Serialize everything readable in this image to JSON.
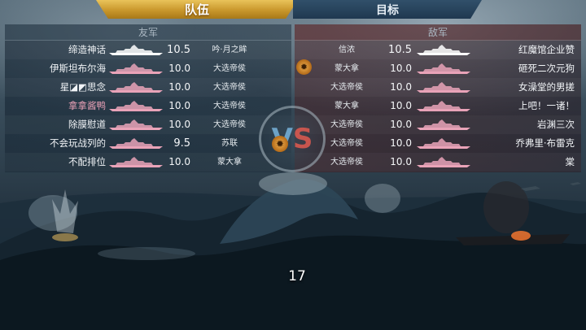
{
  "tabs": {
    "squad_label": "队伍",
    "target_label": "目标"
  },
  "ally": {
    "header": "友军",
    "rows": [
      {
        "player": "缔造神话",
        "tier": "10.5",
        "faction": "吟·月之眸",
        "highlight": false
      },
      {
        "player": "伊斯坦布尔海",
        "tier": "10.0",
        "faction": "大选帝侯",
        "highlight": false
      },
      {
        "player": "星◪◩思念",
        "tier": "10.0",
        "faction": "大选帝侯",
        "highlight": false
      },
      {
        "player": "拿拿酱鸭",
        "tier": "10.0",
        "faction": "大选帝侯",
        "highlight": true
      },
      {
        "player": "除膜慰道",
        "tier": "10.0",
        "faction": "大选帝侯",
        "highlight": false
      },
      {
        "player": "不会玩战列的",
        "tier": "9.5",
        "faction": "苏联",
        "highlight": false
      },
      {
        "player": "不配排位",
        "tier": "10.0",
        "faction": "蒙大拿",
        "highlight": false
      }
    ]
  },
  "enemy": {
    "header": "敌军",
    "rows": [
      {
        "faction": "信浓",
        "tier": "10.5",
        "player": "红魔馆企业赞"
      },
      {
        "faction": "蒙大拿",
        "tier": "10.0",
        "player": "砸死二次元狗"
      },
      {
        "faction": "大选帝侯",
        "tier": "10.0",
        "player": "女澡堂的男搓"
      },
      {
        "faction": "蒙大拿",
        "tier": "10.0",
        "player": "上吧！一诸！"
      },
      {
        "faction": "大选帝侯",
        "tier": "10.0",
        "player": "岩渊三次"
      },
      {
        "faction": "大选帝侯",
        "tier": "10.0",
        "player": "乔弗里·布雷克"
      },
      {
        "faction": "大选帝侯",
        "tier": "10.0",
        "player": "棠"
      }
    ]
  },
  "vs": {
    "v": "V",
    "s": "S"
  },
  "countdown": "17",
  "icons": {
    "ship": "battleship-silhouette-icon",
    "emblem": "ship-wheel-emblem-icon"
  },
  "colors": {
    "accent_gold": "#d4a23a",
    "ally_ship": "#e9a3b8",
    "highlight_name": "#e8a0b6",
    "enemy_tint": "#6e2a2e"
  }
}
